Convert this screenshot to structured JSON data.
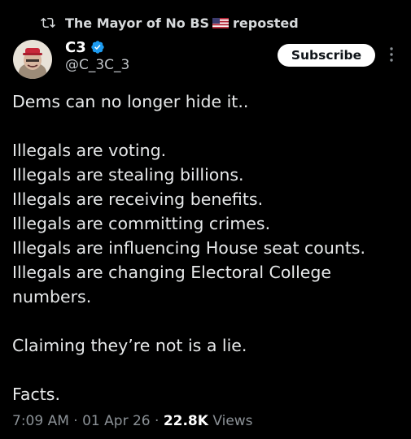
{
  "repost": {
    "reposter_name": "The Mayor of No BS",
    "flag_icon": "us-flag-icon",
    "suffix": "reposted",
    "icon": "repost-icon"
  },
  "author": {
    "display_name": "C3",
    "handle": "@C_3C_3",
    "verified_icon": "verified-badge-icon",
    "verified_color": "#1d9bf0"
  },
  "actions": {
    "subscribe_label": "Subscribe",
    "more_icon": "more-vertical-icon"
  },
  "post": {
    "lines": [
      "Dems can no longer hide it..",
      "",
      "Illegals are voting.",
      "Illegals are stealing billions.",
      "Illegals are receiving benefits.",
      "Illegals are committing crimes.",
      "Illegals are influencing House seat counts.",
      "Illegals are changing Electoral College",
      "numbers.",
      "",
      "Claiming they’re not is a lie.",
      "",
      "Facts."
    ]
  },
  "meta": {
    "time": "7:09 AM",
    "separator": "·",
    "date": "01 Apr 26",
    "views_count": "22.8K",
    "views_label": "Views"
  },
  "colors": {
    "background": "#000000",
    "text": "#e7e9ea",
    "secondary_text": "#8b9196",
    "button_bg": "#ffffff"
  }
}
